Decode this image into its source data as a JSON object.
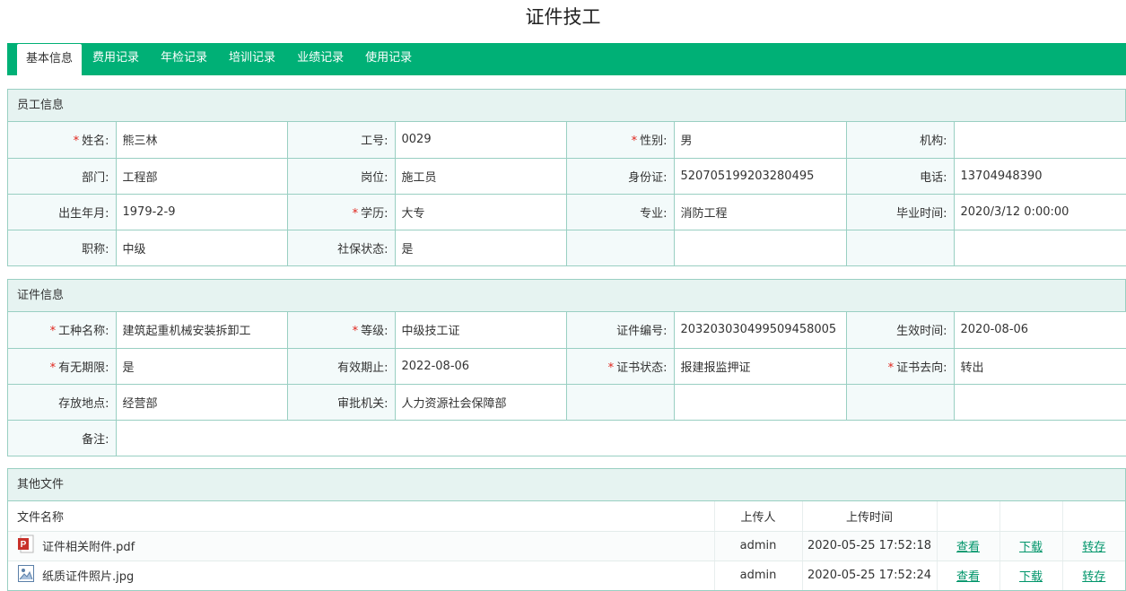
{
  "page": {
    "title": "证件技工"
  },
  "tabs": [
    {
      "label": "基本信息",
      "active": true
    },
    {
      "label": "费用记录",
      "active": false
    },
    {
      "label": "年检记录",
      "active": false
    },
    {
      "label": "培训记录",
      "active": false
    },
    {
      "label": "业绩记录",
      "active": false
    },
    {
      "label": "使用记录",
      "active": false
    }
  ],
  "employee": {
    "section_title": "员工信息",
    "fields": {
      "name": {
        "label": "姓名:",
        "value": "熊三林",
        "required": true
      },
      "emp_no": {
        "label": "工号:",
        "value": "0029"
      },
      "gender": {
        "label": "性别:",
        "value": "男",
        "required": true
      },
      "org": {
        "label": "机构:",
        "value": ""
      },
      "dept": {
        "label": "部门:",
        "value": "工程部"
      },
      "position": {
        "label": "岗位:",
        "value": "施工员"
      },
      "id_card": {
        "label": "身份证:",
        "value": "520705199203280495"
      },
      "phone": {
        "label": "电话:",
        "value": "13704948390"
      },
      "birth": {
        "label": "出生年月:",
        "value": "1979-2-9"
      },
      "education": {
        "label": "学历:",
        "value": "大专",
        "required": true
      },
      "major": {
        "label": "专业:",
        "value": "消防工程"
      },
      "grad_time": {
        "label": "毕业时间:",
        "value": "2020/3/12 0:00:00"
      },
      "title": {
        "label": "职称:",
        "value": "中级"
      },
      "social": {
        "label": "社保状态:",
        "value": "是"
      }
    }
  },
  "certificate": {
    "section_title": "证件信息",
    "fields": {
      "trade": {
        "label": "工种名称:",
        "value": "建筑起重机械安装拆卸工",
        "required": true
      },
      "level": {
        "label": "等级:",
        "value": "中级技工证",
        "required": true
      },
      "cert_no": {
        "label": "证件编号:",
        "value": "203203030499509458005"
      },
      "effective": {
        "label": "生效时间:",
        "value": "2020-08-06"
      },
      "indefinite": {
        "label": "有无期限:",
        "value": "是",
        "required": true
      },
      "expire": {
        "label": "有效期止:",
        "value": "2022-08-06"
      },
      "status": {
        "label": "证书状态:",
        "value": "报建报监押证",
        "required": true
      },
      "whereabouts": {
        "label": "证书去向:",
        "value": "转出",
        "required": true
      },
      "storage": {
        "label": "存放地点:",
        "value": "经营部"
      },
      "authority": {
        "label": "审批机关:",
        "value": "人力资源社会保障部"
      },
      "remark": {
        "label": "备注:",
        "value": ""
      }
    }
  },
  "files": {
    "section_title": "其他文件",
    "columns": {
      "name": "文件名称",
      "uploader": "上传人",
      "time": "上传时间"
    },
    "actions": {
      "view": "查看",
      "download": "下载",
      "transfer": "转存"
    },
    "rows": [
      {
        "icon": "pdf-file-icon",
        "name": "证件相关附件.pdf",
        "uploader": "admin",
        "time": "2020-05-25 17:52:18"
      },
      {
        "icon": "image-file-icon",
        "name": "纸质证件照片.jpg",
        "uploader": "admin",
        "time": "2020-05-25 17:52:24"
      }
    ]
  },
  "colors": {
    "accent": "#00b076",
    "required": "#e0241b",
    "border": "#99cfc2",
    "link": "#00956a"
  }
}
